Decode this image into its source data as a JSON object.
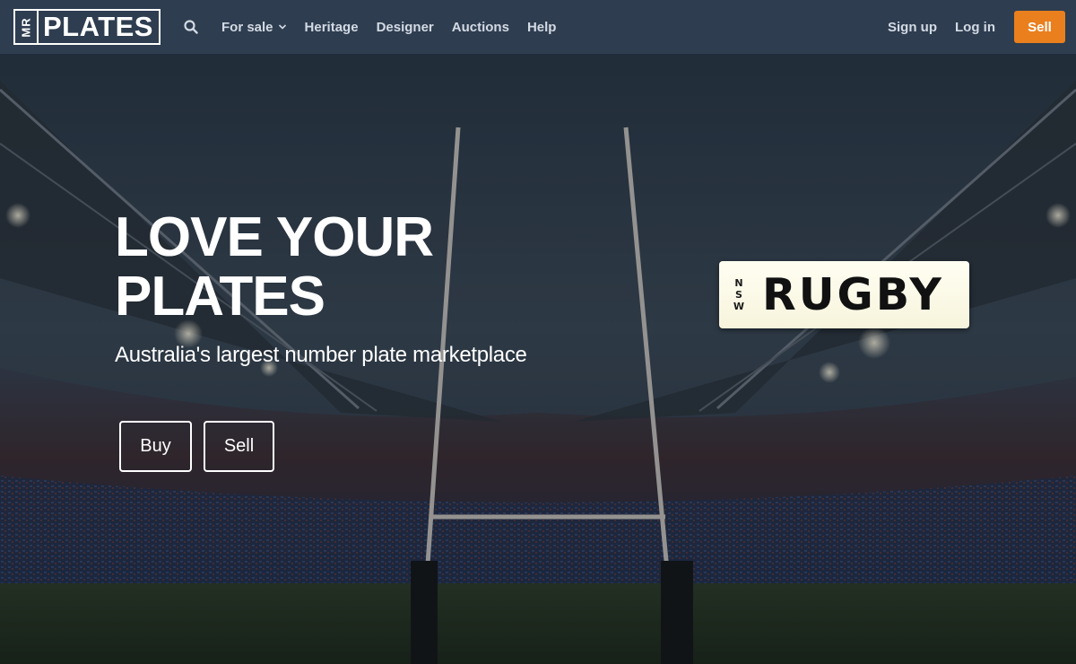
{
  "brand": {
    "logo_small": "MR",
    "logo_main": "PLATES"
  },
  "nav": {
    "search_icon": "search-icon",
    "items": [
      {
        "label": "For sale",
        "dropdown": true
      },
      {
        "label": "Heritage"
      },
      {
        "label": "Designer"
      },
      {
        "label": "Auctions"
      },
      {
        "label": "Help"
      }
    ],
    "signup": "Sign up",
    "login": "Log in",
    "sell": "Sell"
  },
  "hero": {
    "title_line1": "LOVE YOUR",
    "title_line2": "PLATES",
    "subtitle": "Australia's largest number plate marketplace",
    "buy_button": "Buy",
    "sell_button": "Sell"
  },
  "plate": {
    "state_letters": [
      "N",
      "S",
      "W"
    ],
    "text": "RUGBY"
  },
  "colors": {
    "nav_bg": "#2e3d50",
    "accent": "#ea7f1e",
    "plate_bg": "#fffef2"
  }
}
